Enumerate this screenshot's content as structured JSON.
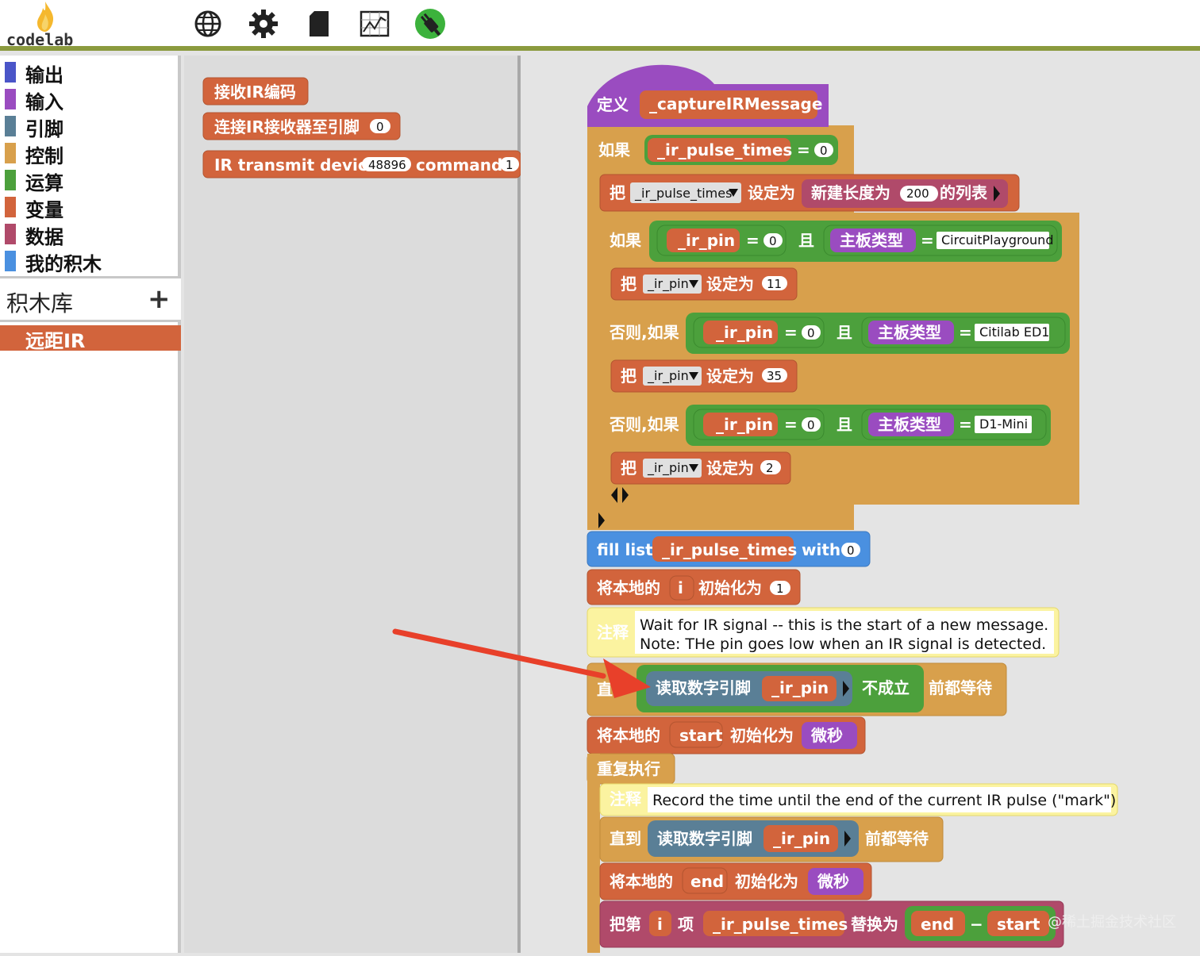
{
  "app": {
    "logo_text": "codelab"
  },
  "toolbar": {
    "icons": [
      "globe-icon",
      "gear-icon",
      "file-icon",
      "chart-icon",
      "usb-plug-icon"
    ]
  },
  "sidebar": {
    "categories": [
      {
        "label": "输出",
        "color": "#4a55c8"
      },
      {
        "label": "输入",
        "color": "#9a4cc0"
      },
      {
        "label": "引脚",
        "color": "#5a7f96"
      },
      {
        "label": "控制",
        "color": "#d8a04c"
      },
      {
        "label": "运算",
        "color": "#4ca03c"
      },
      {
        "label": "变量",
        "color": "#d2643c"
      },
      {
        "label": "数据",
        "color": "#b04a6a"
      },
      {
        "label": "我的积木",
        "color": "#4a90e0"
      }
    ],
    "library_title": "积木库",
    "library_add": "+",
    "library_selected": "远距IR"
  },
  "flyout": {
    "blocks": [
      {
        "label": "接收IR编码"
      },
      {
        "label": "连接IR接收器至引脚",
        "value": "0"
      },
      {
        "label": "IR transmit device",
        "device": "48896",
        "command_label": "command",
        "command": "1"
      }
    ]
  },
  "program": {
    "define": "定义",
    "func_name": "_captureIRMessage",
    "if": "如果",
    "else_if": "否则,如果",
    "and": "且",
    "eq": "=",
    "minus": "−",
    "set": "把",
    "set_to": "设定为",
    "pulse_var": "_ir_pulse_times",
    "pin_var": "_ir_pin",
    "zero": "0",
    "new_list": "新建长度为",
    "list_len": "200",
    "list_suffix": "的列表",
    "board_type": "主板类型",
    "boards": [
      "CircuitPlayground",
      "Citilab ED1",
      "D1-Mini"
    ],
    "pins": [
      "11",
      "35",
      "2"
    ],
    "fill_list": "fill list",
    "with": "with",
    "local_var": "将本地的",
    "init_to": "初始化为",
    "var_i": "i",
    "one": "1",
    "comment": "注释",
    "comment1_line1": "Wait for IR signal -- this is the start of a new message.",
    "comment1_line2": "Note: THe pin goes low when an IR signal is detected.",
    "until_short": "直",
    "until": "直到",
    "read_pin": "读取数字引脚",
    "not_true": "不成立",
    "wait_until": "前都等待",
    "var_start": "start",
    "var_end": "end",
    "micros": "微秒",
    "repeat": "重复执行",
    "comment2": "Record the time until the end of the current IR pulse (\"mark\")",
    "replace_item": "把第",
    "item": "项",
    "replace_with": "替换为"
  },
  "watermark": "@稀土掘金技术社区"
}
